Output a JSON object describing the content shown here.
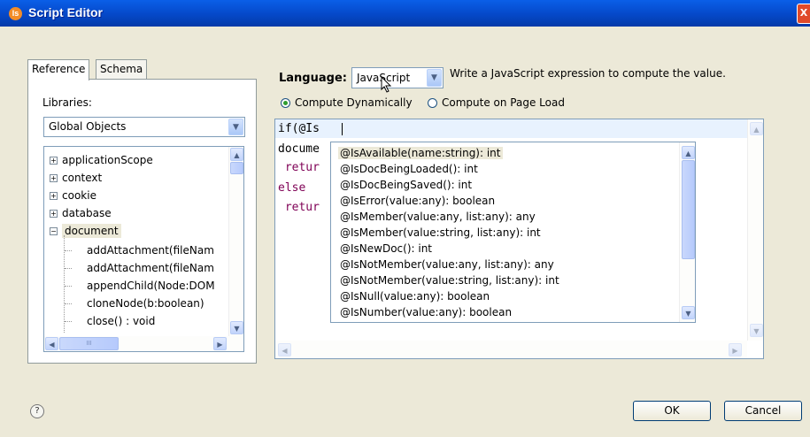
{
  "window": {
    "title": "Script Editor",
    "close_label": "X"
  },
  "reference_panel": {
    "tabs": [
      {
        "label": "Reference",
        "active": true
      },
      {
        "label": "Schema",
        "active": false
      }
    ],
    "libraries_label": "Libraries:",
    "libraries_selected": "Global Objects",
    "tree": [
      {
        "label": "applicationScope",
        "expand": "+"
      },
      {
        "label": "context",
        "expand": "+"
      },
      {
        "label": "cookie",
        "expand": "+"
      },
      {
        "label": "database",
        "expand": "+"
      },
      {
        "label": "document",
        "expand": "−",
        "selected": true
      },
      {
        "label": "addAttachment(fileNam"
      },
      {
        "label": "addAttachment(fileNam"
      },
      {
        "label": "appendChild(Node:DOM"
      },
      {
        "label": "cloneNode(b:boolean)"
      },
      {
        "label": "close() : void"
      }
    ],
    "hscroll_thumb_text": "III"
  },
  "language": {
    "label": "Language:",
    "selected": "JavaScript",
    "hint": "Write a JavaScript expression to compute the value."
  },
  "compute": {
    "dynamic_label": "Compute Dynamically",
    "page_load_label": "Compute on Page Load",
    "selected": "dynamic"
  },
  "editor": {
    "lines": [
      "if(@Is",
      "docume",
      " retur",
      "else",
      " retur"
    ]
  },
  "autocomplete": {
    "items": [
      "@IsAvailable(name:string): int",
      "@IsDocBeingLoaded(): int",
      "@IsDocBeingSaved(): int",
      "@IsError(value:any): boolean",
      "@IsMember(value:any, list:any): any",
      "@IsMember(value:string, list:any): int",
      "@IsNewDoc(): int",
      "@IsNotMember(value:any, list:any): any",
      "@IsNotMember(value:string, list:any): int",
      "@IsNull(value:any): boolean",
      "@IsNumber(value:any): boolean"
    ],
    "highlighted_index": 0
  },
  "footer": {
    "help_glyph": "?",
    "ok_label": "OK",
    "cancel_label": "Cancel"
  },
  "colors": {
    "titlebar": "#0548c8",
    "dialog_bg": "#ece9d8",
    "code_keyword": "#7f0055",
    "current_line": "#e8f2fe"
  }
}
